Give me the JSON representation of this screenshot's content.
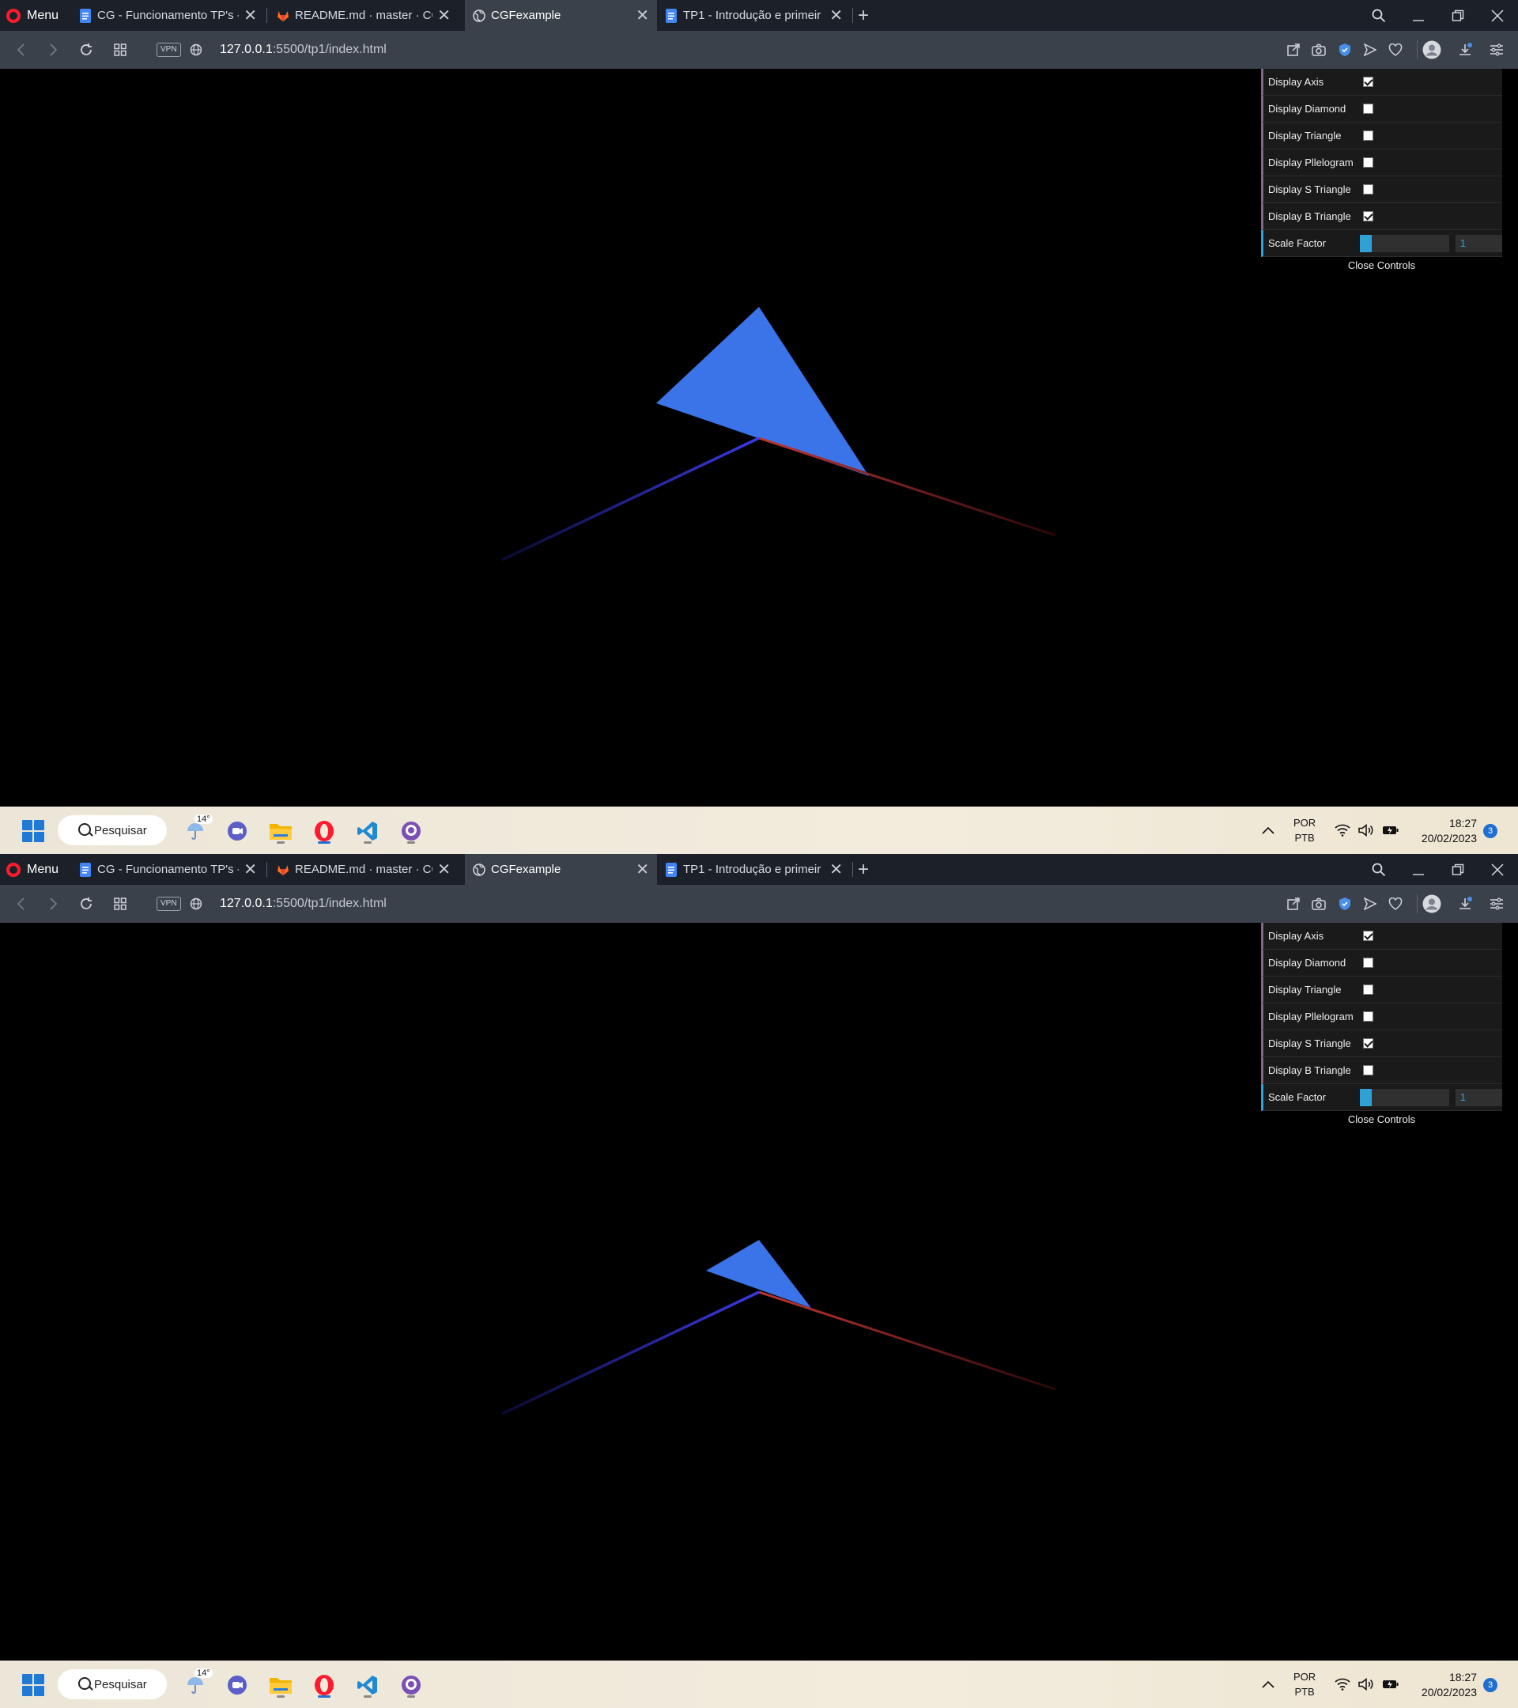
{
  "screens": [
    {
      "browser": {
        "menu_label": "Menu",
        "tabs": [
          {
            "title": "CG - Funcionamento TP's -",
            "active": false,
            "icon": "docs-icon"
          },
          {
            "title": "README.md · master · CG /",
            "active": false,
            "icon": "gitlab-icon"
          },
          {
            "title": "CGFexample",
            "active": true,
            "icon": "globe-icon"
          },
          {
            "title": "TP1 - Introdução e primeir",
            "active": false,
            "icon": "docs-icon"
          }
        ],
        "vpn_label": "VPN",
        "url_host": "127.0.0.1",
        "url_path": ":5500/tp1/index.html"
      },
      "gui": {
        "controls": [
          {
            "label": "Display Axis",
            "checked": true
          },
          {
            "label": "Display Diamond",
            "checked": false
          },
          {
            "label": "Display Triangle",
            "checked": false
          },
          {
            "label": "Display Pllelogram",
            "checked": false
          },
          {
            "label": "Display S Triangle",
            "checked": false
          },
          {
            "label": "Display B Triangle",
            "checked": true
          }
        ],
        "scale_label": "Scale Factor",
        "scale_value": "1",
        "scale_fill_fraction": 0.13,
        "close_label": "Close Controls"
      },
      "scene": {
        "shape": "big-triangle",
        "shape_color": "#3b73e8"
      },
      "taskbar": {
        "search_label": "Pesquisar",
        "weather_temp": "14°",
        "lang_1": "POR",
        "lang_2": "PTB",
        "time": "18:27",
        "date": "20/02/2023",
        "notifications": "3"
      }
    },
    {
      "browser": {
        "menu_label": "Menu",
        "tabs": [
          {
            "title": "CG - Funcionamento TP's -",
            "active": false,
            "icon": "docs-icon"
          },
          {
            "title": "README.md · master · CG /",
            "active": false,
            "icon": "gitlab-icon"
          },
          {
            "title": "CGFexample",
            "active": true,
            "icon": "globe-icon"
          },
          {
            "title": "TP1 - Introdução e primeir",
            "active": false,
            "icon": "docs-icon"
          }
        ],
        "vpn_label": "VPN",
        "url_host": "127.0.0.1",
        "url_path": ":5500/tp1/index.html"
      },
      "gui": {
        "controls": [
          {
            "label": "Display Axis",
            "checked": true
          },
          {
            "label": "Display Diamond",
            "checked": false
          },
          {
            "label": "Display Triangle",
            "checked": false
          },
          {
            "label": "Display Pllelogram",
            "checked": false
          },
          {
            "label": "Display S Triangle",
            "checked": true
          },
          {
            "label": "Display B Triangle",
            "checked": false
          }
        ],
        "scale_label": "Scale Factor",
        "scale_value": "1",
        "scale_fill_fraction": 0.13,
        "close_label": "Close Controls"
      },
      "scene": {
        "shape": "small-triangle",
        "shape_color": "#3b73e8"
      },
      "taskbar": {
        "search_label": "Pesquisar",
        "weather_temp": "14°",
        "lang_1": "POR",
        "lang_2": "PTB",
        "time": "18:27",
        "date": "20/02/2023",
        "notifications": "3"
      }
    }
  ],
  "colors": {
    "axis_x": "#b23030",
    "axis_y": "#2f8f2f",
    "axis_z": "#3535d8",
    "gui_bool_border": "#806787",
    "gui_number_accent": "#2fa1d6",
    "taskbar_accent": "#1f6fd1"
  }
}
